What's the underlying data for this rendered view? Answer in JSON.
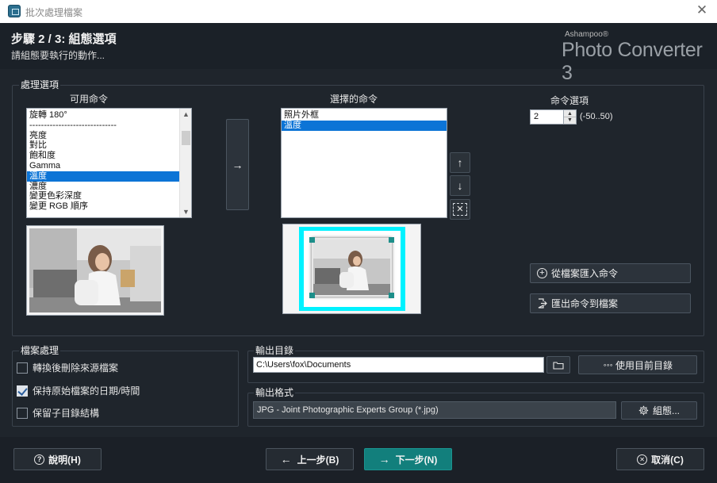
{
  "window": {
    "title": "批次處理檔案",
    "close_glyph": "✕"
  },
  "header": {
    "step_title": "步驟 2 / 3: 組態選項",
    "step_subtitle": "請組態要執行的動作...",
    "brand_small": "Ashampoo®",
    "brand_big": "Photo Converter 3"
  },
  "processing": {
    "legend": "處理選項",
    "available_label": "可用命令",
    "available_items": [
      {
        "label": "旋轉 180°",
        "selected": false
      },
      {
        "label": "------------------------------",
        "selected": false
      },
      {
        "label": "亮度",
        "selected": false
      },
      {
        "label": "對比",
        "selected": false
      },
      {
        "label": "飽和度",
        "selected": false
      },
      {
        "label": "Gamma",
        "selected": false
      },
      {
        "label": "溫度",
        "selected": true
      },
      {
        "label": "濃度",
        "selected": false
      },
      {
        "label": "變更色彩深度",
        "selected": false
      },
      {
        "label": "變更 RGB 順序",
        "selected": false
      }
    ],
    "add_arrow": "→",
    "selected_label": "選擇的命令",
    "selected_items": [
      {
        "label": "照片外框",
        "selected": false
      },
      {
        "label": "溫度",
        "selected": true
      }
    ],
    "move_up": "↑",
    "move_down": "↓",
    "remove": "✕",
    "options_label": "命令選項",
    "option_value": "2",
    "option_range": "(-50..50)",
    "import_label": "從檔案匯入命令",
    "export_label": "匯出命令到檔案"
  },
  "file_handling": {
    "legend": "檔案處理",
    "options": [
      {
        "label": "轉換後刪除來源檔案",
        "checked": false
      },
      {
        "label": "保持原始檔案的日期/時間",
        "checked": true
      },
      {
        "label": "保留子目錄結構",
        "checked": false
      }
    ]
  },
  "output_dir": {
    "legend": "輸出目錄",
    "path": "C:\\Users\\fox\\Documents",
    "use_current_label": "使用目前目錄",
    "dots_glyph": "∘∘∘"
  },
  "output_format": {
    "legend": "輸出格式",
    "format": "JPG - Joint Photographic Experts Group (*.jpg)",
    "configure_label": "組態..."
  },
  "footer": {
    "help_label": "說明(H)",
    "back_label": "上一步(B)",
    "next_label": "下一步(N)",
    "cancel_label": "取消(C)"
  },
  "colors": {
    "background": "#1f252c",
    "selection": "#0c74d6",
    "next_button": "#127f7c",
    "frame_glow": "#00f2ff"
  }
}
